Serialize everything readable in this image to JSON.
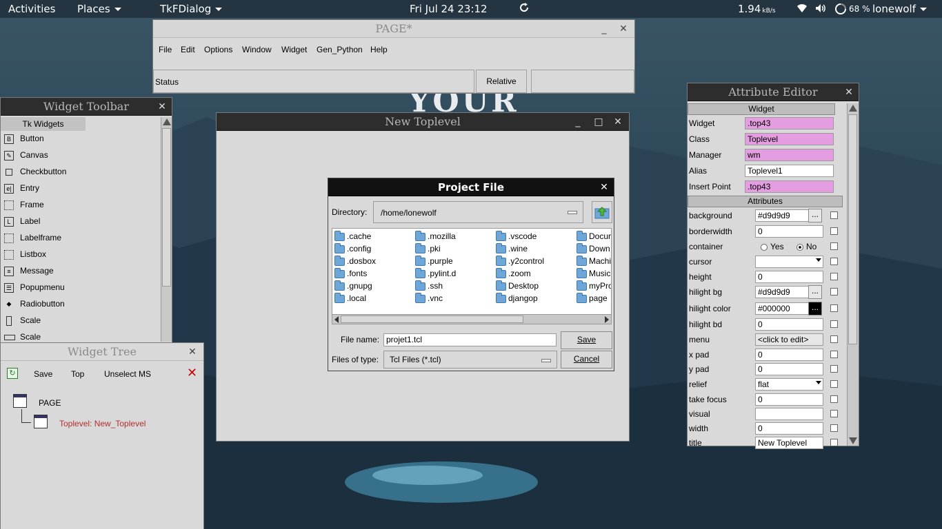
{
  "topbar": {
    "activities": "Activities",
    "places": "Places",
    "app_menu": "TkFDialog",
    "clock": "Fri Jul 24  23:12",
    "net_speed": "1.94",
    "net_unit": "kB/s",
    "battery": "68 %",
    "user": "lonewolf"
  },
  "page_window": {
    "title": "PAGE*",
    "menu": [
      "File",
      "Edit",
      "Options",
      "Window",
      "Widget",
      "Gen_Python",
      "Help"
    ],
    "status": "Status",
    "relative": "Relative"
  },
  "widget_toolbar": {
    "title": "Widget Toolbar",
    "tab": "Tk Widgets",
    "items": [
      {
        "label": "Button",
        "icon": "button-icon"
      },
      {
        "label": "Canvas",
        "icon": "canvas-icon"
      },
      {
        "label": "Checkbutton",
        "icon": "checkbutton-icon"
      },
      {
        "label": "Entry",
        "icon": "entry-icon"
      },
      {
        "label": "Frame",
        "icon": "frame-icon"
      },
      {
        "label": "Label",
        "icon": "label-icon"
      },
      {
        "label": "Labelframe",
        "icon": "labelframe-icon"
      },
      {
        "label": "Listbox",
        "icon": "listbox-icon"
      },
      {
        "label": "Message",
        "icon": "message-icon"
      },
      {
        "label": "Popupmenu",
        "icon": "popupmenu-icon"
      },
      {
        "label": "Radiobutton",
        "icon": "radiobutton-icon"
      },
      {
        "label": "Scale",
        "icon": "scale-icon"
      },
      {
        "label": "Scale",
        "icon": "scale-horizontal-icon"
      }
    ]
  },
  "widget_tree": {
    "title": "Widget Tree",
    "save": "Save",
    "top": "Top",
    "unselect": "Unselect MS",
    "root": "PAGE",
    "child": "Toplevel: New_Toplevel"
  },
  "new_toplevel": {
    "title": "New Toplevel"
  },
  "project_file": {
    "title": "Project File",
    "directory_label": "Directory:",
    "directory_value": "/home/lonewolf",
    "columns": [
      [
        ".cache",
        ".config",
        ".dosbox",
        ".fonts",
        ".gnupg",
        ".local"
      ],
      [
        ".mozilla",
        ".pki",
        ".purple",
        ".pylint.d",
        ".ssh",
        ".vnc"
      ],
      [
        ".vscode",
        ".wine",
        ".y2control",
        ".zoom",
        "Desktop",
        "djangop"
      ],
      [
        "Docur",
        "Down",
        "Machi",
        "Music",
        "myPro",
        "page"
      ]
    ],
    "filename_label": "File name:",
    "filename_value": "projet1.tcl",
    "filetype_label": "Files of type:",
    "filetype_value": "Tcl Files (*.tcl)",
    "save": "Save",
    "cancel": "Cancel"
  },
  "attribute_editor": {
    "title": "Attribute Editor",
    "widget_section": "Widget",
    "widget_rows": [
      {
        "label": "Widget",
        "value": ".top43",
        "pink": true
      },
      {
        "label": "Class",
        "value": "Toplevel",
        "pink": true
      },
      {
        "label": "Manager",
        "value": "wm",
        "pink": true
      },
      {
        "label": "Alias",
        "value": "Toplevel1",
        "pink": false
      },
      {
        "label": "Insert Point",
        "value": ".top43",
        "pink": true
      }
    ],
    "attributes_section": "Attributes",
    "attr_rows": [
      {
        "label": "background",
        "value": "#d9d9d9",
        "kind": "dots"
      },
      {
        "label": "borderwidth",
        "value": "0",
        "kind": "entry"
      },
      {
        "label": "container",
        "value": "",
        "kind": "radio"
      },
      {
        "label": "cursor",
        "value": "",
        "kind": "combo"
      },
      {
        "label": "height",
        "value": "0",
        "kind": "entry"
      },
      {
        "label": "hilight bg",
        "value": "#d9d9d9",
        "kind": "dots"
      },
      {
        "label": "hilight color",
        "value": "#000000",
        "kind": "dots-black"
      },
      {
        "label": "hilight bd",
        "value": "0",
        "kind": "entry"
      },
      {
        "label": "menu",
        "value": "<click to edit>",
        "kind": "button"
      },
      {
        "label": "x pad",
        "value": "0",
        "kind": "entry"
      },
      {
        "label": "y pad",
        "value": "0",
        "kind": "entry"
      },
      {
        "label": "relief",
        "value": "flat",
        "kind": "combo"
      },
      {
        "label": "take focus",
        "value": "0",
        "kind": "entry"
      },
      {
        "label": "visual",
        "value": "",
        "kind": "entry"
      },
      {
        "label": "width",
        "value": "0",
        "kind": "entry"
      },
      {
        "label": "title",
        "value": "New Toplevel",
        "kind": "entry"
      }
    ],
    "container_yes": "Yes",
    "container_no": "No",
    "dots": "..."
  },
  "desktop": {
    "watermark": "YOUR"
  }
}
